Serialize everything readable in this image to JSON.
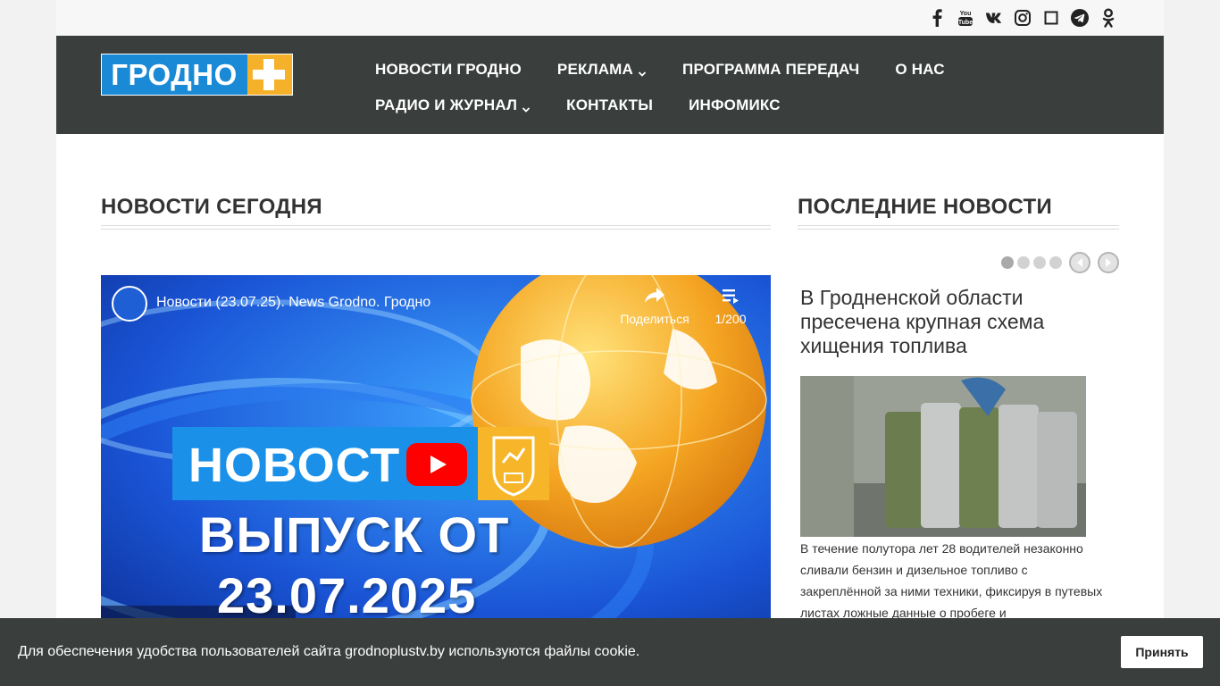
{
  "brand": {
    "logo_text": "ГРОДНО",
    "logo_colors": {
      "blue": "#1b8ad6",
      "orange": "#f6b12b",
      "white": "#ffffff"
    }
  },
  "social_icons": [
    {
      "name": "facebook-icon"
    },
    {
      "name": "youtube-icon",
      "label": "You Tube"
    },
    {
      "name": "vk-icon"
    },
    {
      "name": "instagram-icon"
    },
    {
      "name": "square-icon"
    },
    {
      "name": "telegram-icon"
    },
    {
      "name": "odnoklassniki-icon"
    }
  ],
  "nav": {
    "items": [
      {
        "label": "НОВОСТИ ГРОДНО",
        "dropdown": false
      },
      {
        "label": "РЕКЛАМА",
        "dropdown": true
      },
      {
        "label": "ПРОГРАММА ПЕРЕДАЧ",
        "dropdown": false
      },
      {
        "label": "О НАС",
        "dropdown": false
      },
      {
        "label": "РАДИО И ЖУРНАЛ",
        "dropdown": true
      },
      {
        "label": "КОНТАКТЫ",
        "dropdown": false
      },
      {
        "label": "ИНФОМИКС",
        "dropdown": false
      }
    ]
  },
  "main": {
    "section_title": "НОВОСТИ СЕГОДНЯ",
    "video": {
      "title": "Новости (23.07.25). News Grodno. Гродно",
      "share_label": "Поделиться",
      "playlist_counter": "1/200",
      "banner_text": "НОВОСТ",
      "line1": "ВЫПУСК ОТ",
      "line2": "23.07.2025"
    }
  },
  "sidebar": {
    "section_title": "ПОСЛЕДНИЕ НОВОСТИ",
    "slider": {
      "dots": 4,
      "active_index": 0
    },
    "article": {
      "headline": "В Гродненской области пресечена крупная схема хищения топлива",
      "body": "В течение полутора лет 28 водителей незаконно сливали бензин и дизельное топливо с закреплённой за ними техники, фиксируя в путевых листах ложные данные о пробеге и"
    }
  },
  "cookie": {
    "text": "Для обеспечения удобства пользователей сайта grodnoplustv.by используются файлы cookie.",
    "accept_label": "Принять"
  },
  "colors": {
    "header_bg": "#3a3f3d",
    "cookie_bg": "#3a3f3d",
    "youtube_red": "#ff0000"
  }
}
